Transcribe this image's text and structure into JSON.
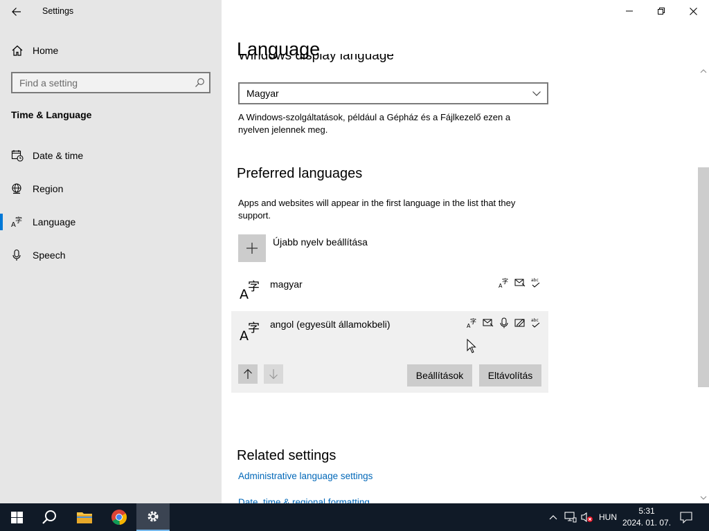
{
  "window": {
    "app_title": "Settings",
    "minimize_symbol": "—",
    "maximize_symbol": "❐",
    "close_symbol": "✕"
  },
  "sidebar": {
    "home_label": "Home",
    "search_placeholder": "Find a setting",
    "section_title": "Time & Language",
    "items": [
      {
        "label": "Date & time",
        "icon": "calendar-clock-icon",
        "selected": false
      },
      {
        "label": "Region",
        "icon": "globe-icon",
        "selected": false
      },
      {
        "label": "Language",
        "icon": "language-icon",
        "selected": true
      },
      {
        "label": "Speech",
        "icon": "microphone-icon",
        "selected": false
      }
    ]
  },
  "main": {
    "page_title": "Language",
    "cut_heading": "Windows display language",
    "display_language_value": "Magyar",
    "display_language_desc": "A Windows-szolgáltatások, például a Gépház és a Fájlkezelő ezen a nyelven jelennek meg.",
    "preferred_heading": "Preferred languages",
    "preferred_desc": "Apps and websites will appear in the first language in the list that they support.",
    "add_language_label": "Újabb nyelv beállítása",
    "languages": [
      {
        "name": "magyar",
        "features": [
          "display-language-icon",
          "text-to-speech-icon",
          "spellcheck-icon"
        ]
      },
      {
        "name": "angol (egyesült államokbeli)",
        "features": [
          "display-language-icon",
          "text-to-speech-icon",
          "speech-recognition-icon",
          "handwriting-icon",
          "spellcheck-icon"
        ]
      }
    ],
    "options_button": "Beállítások",
    "remove_button": "Eltávolítás",
    "related_heading": "Related settings",
    "links": [
      "Administrative language settings",
      "Date, time & regional formatting"
    ]
  },
  "taskbar": {
    "input_language": "HUN",
    "time": "5:31",
    "date": "2024. 01. 07."
  },
  "colors": {
    "accent": "#0078d7",
    "link": "#0067b8",
    "sidebar_bg": "#e6e6e6",
    "taskbar_bg": "#101a27"
  }
}
